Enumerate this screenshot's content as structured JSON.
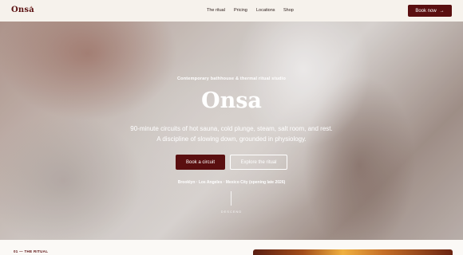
{
  "nav": {
    "logo": "Onsa",
    "logo_mark": "*",
    "links": [
      "The ritual",
      "Pricing",
      "Locations",
      "Shop"
    ],
    "cta_label": "Book now",
    "cta_arrow": "→"
  },
  "hero": {
    "eyebrow": "Contemporary bathhouse & thermal ritual studio",
    "title": "Onsa",
    "subtitle": "90-minute circuits of hot sauna, cold plunge, steam, salt room, and rest. A discipline of slowing down, grounded in physiology.",
    "primary_label": "Book a circuit",
    "secondary_label": "Explore the ritual",
    "cities": "Brooklyn · Los Angeles · Mexico City (opening late 2026)",
    "scroll_label": "DESCEND"
  },
  "section": {
    "eyebrow": "01 — THE RITUAL"
  },
  "colors": {
    "brand": "#5a0f10",
    "background": "#f6f2ec"
  }
}
